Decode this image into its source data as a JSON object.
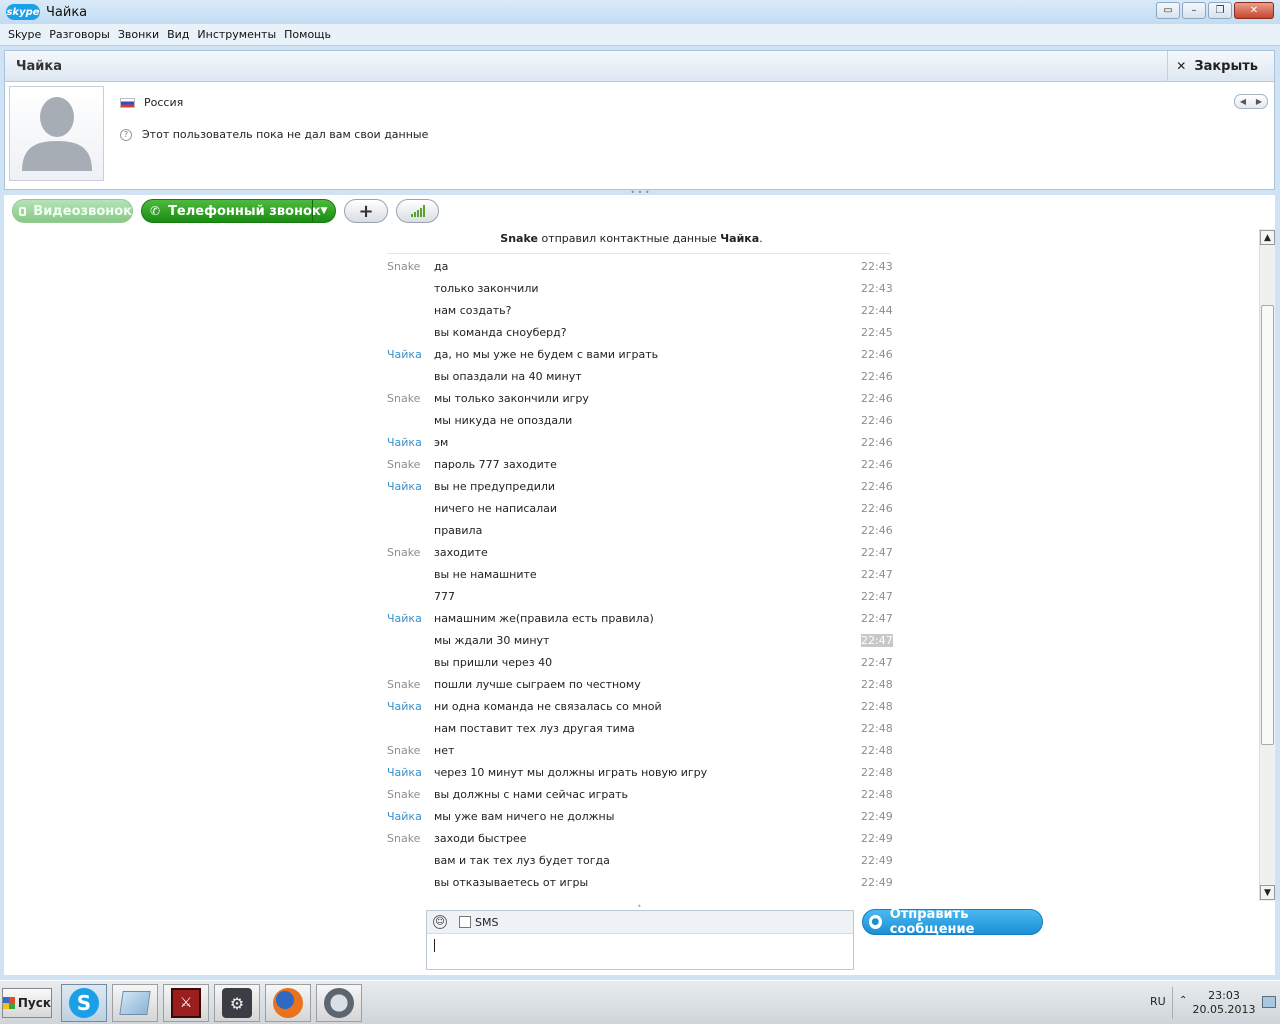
{
  "window": {
    "logo_text": "skype",
    "title": "Чайка",
    "controls": [
      "▭",
      "–",
      "❐",
      "✕"
    ]
  },
  "menu": [
    "Skype",
    "Разговоры",
    "Звонки",
    "Вид",
    "Инструменты",
    "Помощь"
  ],
  "contact": {
    "name": "Чайка",
    "close_label": "Закрыть",
    "country": "Россия",
    "mood": "Этот пользователь пока не дал вам свои данные"
  },
  "call_buttons": {
    "video": "Видеозвонок",
    "phone": "Телефонный звонок"
  },
  "chat": {
    "system_sender": "Snake",
    "system_text": " отправил контактные данные ",
    "system_contact": "Чайка",
    "messages": [
      {
        "who": "Snake",
        "text": "да",
        "time": "22:43"
      },
      {
        "who": "",
        "text": "только закончили",
        "time": "22:43"
      },
      {
        "who": "",
        "text": "нам создать?",
        "time": "22:44"
      },
      {
        "who": "",
        "text": "вы команда сноуберд?",
        "time": "22:45"
      },
      {
        "who": "Чайка",
        "text": "да, но мы уже не будем с вами играть",
        "time": "22:46"
      },
      {
        "who": "",
        "text": "вы опаздали на 40 минут",
        "time": "22:46"
      },
      {
        "who": "Snake",
        "text": "мы только закончили игру",
        "time": "22:46"
      },
      {
        "who": "",
        "text": "мы никуда не опоздали",
        "time": "22:46"
      },
      {
        "who": "Чайка",
        "text": "эм",
        "time": "22:46"
      },
      {
        "who": "Snake",
        "text": "пароль 777 заходите",
        "time": "22:46"
      },
      {
        "who": "Чайка",
        "text": "вы не предупредили",
        "time": "22:46"
      },
      {
        "who": "",
        "text": "ничего не написалаи",
        "time": "22:46"
      },
      {
        "who": "",
        "text": "правила",
        "time": "22:46"
      },
      {
        "who": "Snake",
        "text": "заходите",
        "time": "22:47"
      },
      {
        "who": "",
        "text": "вы не намашните",
        "time": "22:47"
      },
      {
        "who": "",
        "text": "777",
        "time": "22:47"
      },
      {
        "who": "Чайка",
        "text": "намашним же(правила есть правила)",
        "time": "22:47"
      },
      {
        "who": "",
        "text": "мы ждали 30 минут",
        "time": "22:47",
        "highlight": true
      },
      {
        "who": "",
        "text": "вы пришли через 40",
        "time": "22:47"
      },
      {
        "who": "Snake",
        "text": "пошли лучше сыграем по честному",
        "time": "22:48"
      },
      {
        "who": "Чайка",
        "text": "ни одна команда не связалась со мной",
        "time": "22:48"
      },
      {
        "who": "",
        "text": "нам поставит тех луз другая тима",
        "time": "22:48"
      },
      {
        "who": "Snake",
        "text": "нет",
        "time": "22:48"
      },
      {
        "who": "Чайка",
        "text": "через 10 минут мы должны играть новую игру",
        "time": "22:48"
      },
      {
        "who": "Snake",
        "text": "вы должны с нами сейчас играть",
        "time": "22:48"
      },
      {
        "who": "Чайка",
        "text": "мы уже вам ничего не должны",
        "time": "22:49"
      },
      {
        "who": "Snake",
        "text": "заходи быстрее",
        "time": "22:49"
      },
      {
        "who": "",
        "text": "вам и так тех луз будет тогда",
        "time": "22:49"
      },
      {
        "who": "",
        "text": "вы отказываетесь от игры",
        "time": "22:49"
      }
    ]
  },
  "compose": {
    "sms_label": "SMS",
    "send_label": "Отправить сообщение"
  },
  "taskbar": {
    "start_label": "Пуск",
    "apps": [
      "skype-icon",
      "notepad-icon",
      "dota-icon",
      "steam-icon",
      "firefox-icon",
      "teamspeak-icon"
    ],
    "lang": "RU",
    "time": "23:03",
    "date": "20.05.2013"
  },
  "colors": {
    "chaika_name": "#3c8fc8",
    "snake_name": "#8a8f95",
    "phone_green": "#1a8d12",
    "send_blue": "#1a8fd6"
  }
}
